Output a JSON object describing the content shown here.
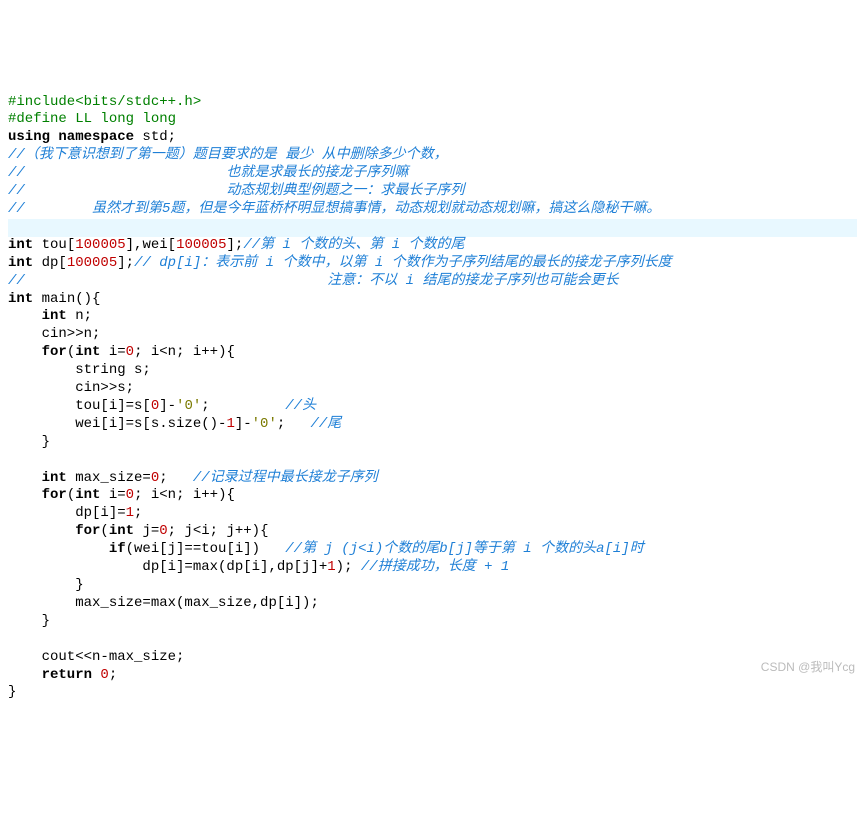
{
  "watermark": "CSDN @我叫Ycg",
  "l1_pp": "#include<bits/stdc++.h>",
  "l2_pp": "#define LL long long",
  "l3_a": "using namespace",
  "l3_b": " std;",
  "c1": "//（我下意识想到了第一题）题目要求的是 最少 从中删除多少个数，",
  "c2": "//                        也就是求最长的接龙子序列嘛",
  "c3": "//                        动态规划典型例题之一：求最长子序列",
  "c4": "//        虽然才到第5题，但是今年蓝桥杯明显想搞事情，动态规划就动态规划嘛，搞这么隐秘干嘛。",
  "d1_a": "int",
  "d1_b": " tou[",
  "d1_n1": "100005",
  "d1_c": "],wei[",
  "d1_n2": "100005",
  "d1_d": "];",
  "d1_cmt": "//第 i 个数的头、第 i 个数的尾",
  "d2_a": "int",
  "d2_b": " dp[",
  "d2_n": "100005",
  "d2_c": "];",
  "d2_cmt": "// dp[i]：表示前 i 个数中，以第 i 个数作为子序列结尾的最长的接龙子序列长度",
  "d3_cmt": "//                                    注意：不以 i 结尾的接龙子序列也可能会更长",
  "m1_a": "int",
  "m1_b": " main(){",
  "m2_a": "    int",
  "m2_b": " n;",
  "m3": "    cin>>n;",
  "m4_a": "    for",
  "m4_b": "(",
  "m4_c": "int",
  "m4_d": " i=",
  "m4_n0": "0",
  "m4_e": "; i<n; i++){",
  "m5": "        string s;",
  "m6": "        cin>>s;",
  "m7_a": "        tou[i]=s[",
  "m7_n": "0",
  "m7_b": "]-",
  "m7_s": "'0'",
  "m7_c": ";         ",
  "m7_cmt": "//头",
  "m8_a": "        wei[i]=s[s.size()-",
  "m8_n": "1",
  "m8_b": "]-",
  "m8_s": "'0'",
  "m8_c": ";   ",
  "m8_cmt": "//尾",
  "m9": "    }",
  "mx_a": "    int",
  "mx_b": " max_size=",
  "mx_n": "0",
  "mx_c": ";   ",
  "mx_cmt": "//记录过程中最长接龙子序列",
  "f2_a": "    for",
  "f2_b": "(",
  "f2_c": "int",
  "f2_d": " i=",
  "f2_n0": "0",
  "f2_e": "; i<n; i++){",
  "f3_a": "        dp[i]=",
  "f3_n": "1",
  "f3_b": ";",
  "f4_a": "        for",
  "f4_b": "(",
  "f4_c": "int",
  "f4_d": " j=",
  "f4_n0": "0",
  "f4_e": "; j<i; j++){",
  "f5_a": "            if",
  "f5_b": "(wei[j]==tou[i])   ",
  "f5_cmt": "//第 j (j<i)个数的尾b[j]等于第 i 个数的头a[i]时",
  "f6_a": "                dp[i]=max(dp[i],dp[j]+",
  "f6_n": "1",
  "f6_b": "); ",
  "f6_cmt": "//拼接成功，长度 + 1",
  "f7": "        }",
  "f8": "        max_size=max(max_size,dp[i]);",
  "f9": "    }",
  "out": "    cout<<n-max_size;",
  "ret_a": "    return",
  "ret_b": " ",
  "ret_n": "0",
  "ret_c": ";",
  "end": "}"
}
